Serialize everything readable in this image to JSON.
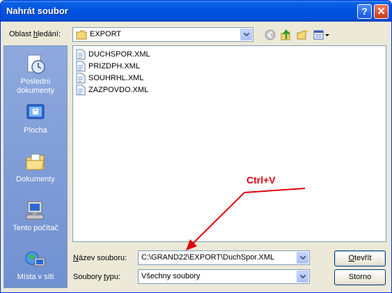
{
  "window": {
    "title": "Nahrát soubor"
  },
  "titlebar": {
    "help_glyph": "?",
    "close_glyph": "✕"
  },
  "lookin": {
    "label_pre": "Oblast ",
    "label_u": "h",
    "label_post": "ledání:",
    "value": "EXPORT",
    "icon": "folder-icon"
  },
  "toolbar": {
    "icons": [
      "back-icon",
      "up-folder-icon",
      "new-folder-icon",
      "view-menu-icon"
    ]
  },
  "places": [
    {
      "label_lines": [
        "Poslední",
        "dokumenty"
      ],
      "icon": "recent-documents-icon"
    },
    {
      "label_lines": [
        "Plocha"
      ],
      "icon": "desktop-icon"
    },
    {
      "label_lines": [
        "Dokumenty"
      ],
      "icon": "documents-folder-icon"
    },
    {
      "label_lines": [
        "Tento počítač"
      ],
      "icon": "computer-icon"
    },
    {
      "label_lines": [
        "Místa v síti"
      ],
      "icon": "network-icon"
    }
  ],
  "files": [
    "DUCHSPOR.XML",
    "PRIZDPH.XML",
    "SOUHRHL.XML",
    "ZAZPOVDO.XML"
  ],
  "filename": {
    "label_u": "N",
    "label_post": "ázev souboru:",
    "value": "C:\\GRAND22\\EXPORT\\DuchSpor.XML"
  },
  "filetype": {
    "label_pre": "Soubory ",
    "label_u": "t",
    "label_post": "ypu:",
    "value": "Všechny soubory"
  },
  "buttons": {
    "open_pre": "",
    "open_u": "O",
    "open_post": "tevřít",
    "cancel": "Storno"
  },
  "annotation": {
    "text": "Ctrl+V",
    "color": "#e0000f"
  }
}
